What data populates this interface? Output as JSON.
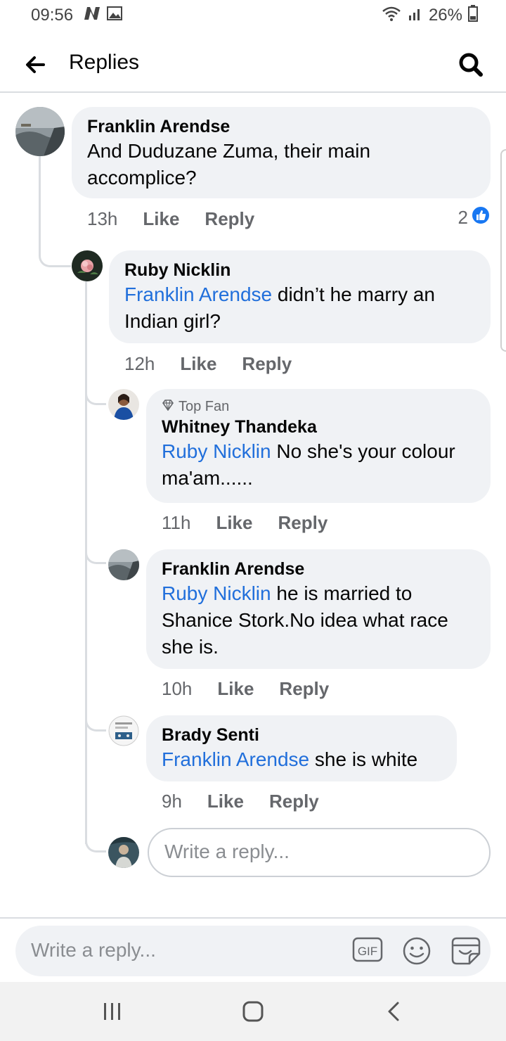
{
  "status_bar": {
    "time": "09:56",
    "battery": "26%"
  },
  "header": {
    "title": "Replies"
  },
  "comments": [
    {
      "author": "Franklin Arendse",
      "text": "And Duduzane Zuma, their main accomplice?",
      "time": "13h",
      "like": "Like",
      "reply": "Reply",
      "reaction_count": "2"
    },
    {
      "author": "Ruby Nicklin",
      "mention": "Franklin Arendse",
      "text": " didn’t he marry an Indian girl?",
      "time": "12h",
      "like": "Like",
      "reply": "Reply"
    },
    {
      "badge": "Top Fan",
      "author": "Whitney Thandeka",
      "mention": "Ruby Nicklin",
      "text": " No she's your colour ma'am......",
      "time": "11h",
      "like": "Like",
      "reply": "Reply"
    },
    {
      "author": "Franklin Arendse",
      "mention": "Ruby Nicklin",
      "text": " he is married to Shanice Stork.No idea what race she is.",
      "time": "10h",
      "like": "Like",
      "reply": "Reply"
    },
    {
      "author": "Brady Senti",
      "mention": "Franklin Arendse",
      "text": " she is white",
      "time": "9h",
      "like": "Like",
      "reply": "Reply"
    }
  ],
  "inline_reply": {
    "placeholder": "Write a reply..."
  },
  "composer": {
    "placeholder": "Write a reply...",
    "gif_label": "GIF"
  },
  "colors": {
    "mention": "#216fdb",
    "bubble": "#f0f2f5",
    "like_blue": "#1877f2"
  },
  "icons": [
    "back-arrow-icon",
    "search-icon",
    "like-thumb-icon",
    "diamond-icon",
    "gif-icon",
    "emoji-icon",
    "sticker-icon",
    "recents-icon",
    "home-icon",
    "back-icon"
  ]
}
